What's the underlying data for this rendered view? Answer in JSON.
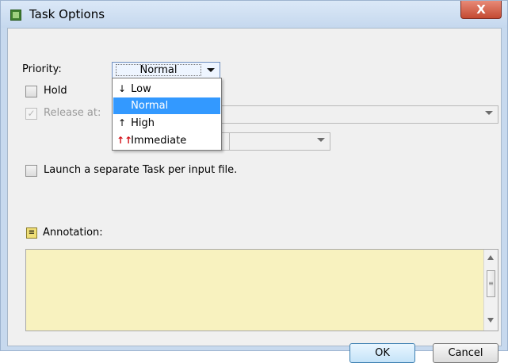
{
  "window": {
    "title": "Task Options",
    "close_glyph": "X"
  },
  "priority": {
    "label": "Priority:",
    "value": "Normal",
    "options": [
      {
        "label": "Low",
        "icon": "↓",
        "icon_name": "down-arrow-icon"
      },
      {
        "label": "Normal",
        "icon": "",
        "icon_name": ""
      },
      {
        "label": "High",
        "icon": "↑",
        "icon_name": "up-arrow-icon"
      },
      {
        "label": "Immediate",
        "icon": "↑↑",
        "icon_name": "double-up-arrow-icon",
        "icon_color": "#d3141b"
      }
    ]
  },
  "hold": {
    "label": "Hold",
    "checked": false
  },
  "release": {
    "label": "Release at:",
    "checked": true,
    "disabled": true
  },
  "launch": {
    "label": "Launch a separate Task per input file.",
    "checked": false
  },
  "annotation": {
    "label": "Annotation:",
    "icon": "annotation-icon",
    "value": ""
  },
  "buttons": {
    "ok": "OK",
    "cancel": "Cancel"
  },
  "colors": {
    "selection": "#3399ff",
    "annotation_bg": "#f8f2bf",
    "title_bar": "#c7d9ee",
    "close_button": "#c44a32"
  }
}
